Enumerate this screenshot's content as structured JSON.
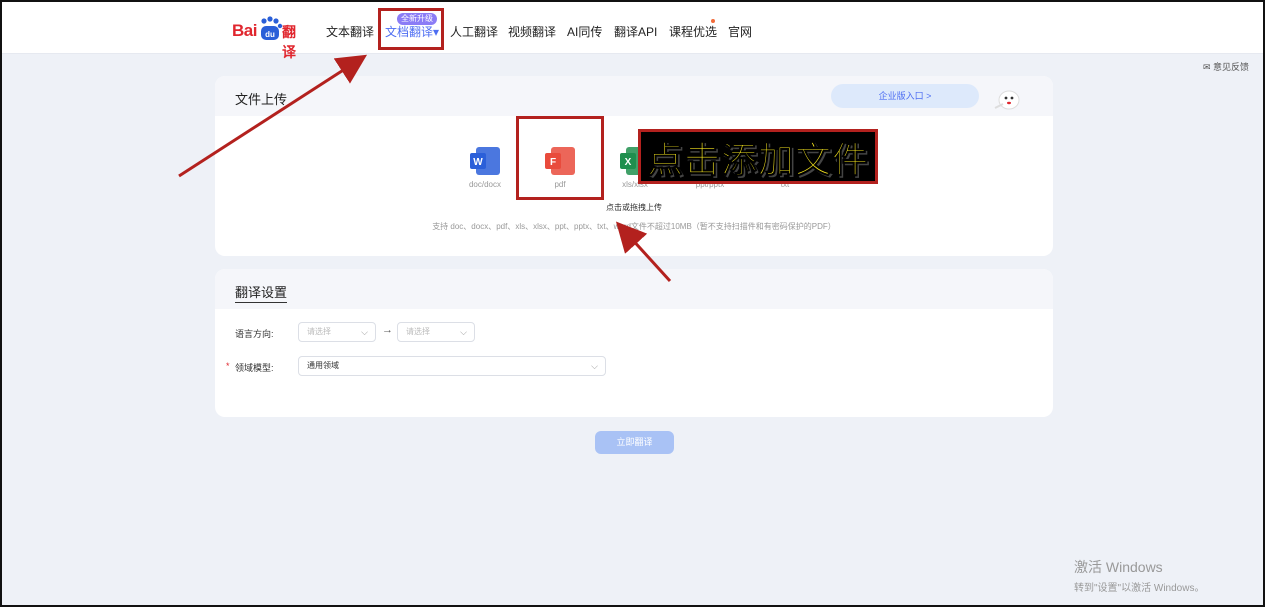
{
  "header": {
    "logo_text_bai": "Bai",
    "logo_text_du": "du",
    "logo_text_fanyi": "翻译",
    "nav": [
      {
        "label": "文本翻译"
      },
      {
        "label": "文档翻译▾"
      },
      {
        "label": "人工翻译"
      },
      {
        "label": "视频翻译"
      },
      {
        "label": "AI同传"
      },
      {
        "label": "翻译API"
      },
      {
        "label": "课程优选"
      },
      {
        "label": "官网"
      }
    ],
    "new_badge": "全新升级"
  },
  "feedback": "✉ 意见反馈",
  "upload_card": {
    "title": "文件上传",
    "enterprise_link": "企业版入口 >",
    "file_types": [
      {
        "label": "doc/docx",
        "icon": "word-icon",
        "color": "#2b5fd9",
        "letter": "W"
      },
      {
        "label": "pdf",
        "icon": "pdf-icon",
        "color": "#e94b3c",
        "letter": "F"
      },
      {
        "label": "xls/xlsx",
        "icon": "excel-icon",
        "color": "#1f8f4e",
        "letter": "X"
      },
      {
        "label": "ppt/pptx",
        "icon": "ppt-icon",
        "color": "#d9572b",
        "letter": "P"
      },
      {
        "label": "txt",
        "icon": "txt-icon",
        "color": "#6b7ae0",
        "letter": "T"
      }
    ],
    "upload_tip": "点击或拖拽上传",
    "support_text": "支持 doc、docx、pdf、xls、xlsx、ppt、pptx、txt、word文件不超过10MB（暂不支持扫描件和有密码保护的PDF）"
  },
  "settings_card": {
    "title": "翻译设置",
    "lang_label": "语言方向:",
    "source_placeholder": "请选择",
    "target_placeholder": "请选择",
    "arrow": "→",
    "domain_label": "领域模型:",
    "domain_required_mark": "*",
    "domain_value": "通用领域"
  },
  "translate_button": "立即翻译",
  "annotation": {
    "callout_text": "点击添加文件",
    "color": "#b3211e"
  },
  "windows_watermark": {
    "line1": "激活 Windows",
    "line2": "转到\"设置\"以激活 Windows。"
  }
}
